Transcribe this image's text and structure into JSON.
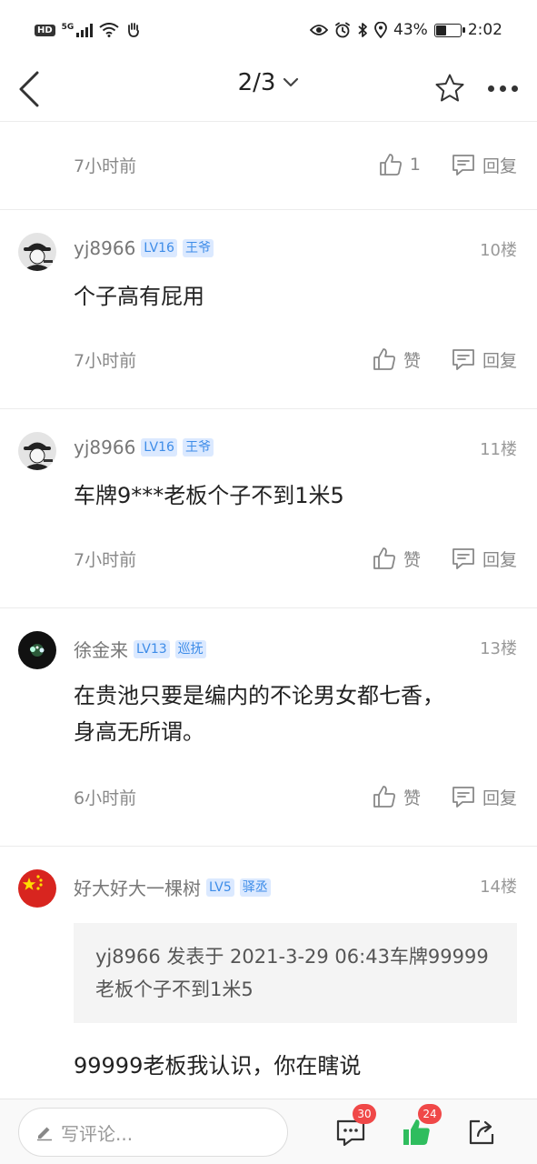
{
  "status": {
    "hd": "HD",
    "network": "5G",
    "battery": "43%",
    "battery_level": 0.43,
    "time": "2:02"
  },
  "nav": {
    "page_indicator": "2/3"
  },
  "colors": {
    "badge_bg": "#dbe9ff",
    "badge_text": "#3d8ce8",
    "like_active": "#2fbd5e",
    "count_badge": "#f04848"
  },
  "comments": [
    {
      "time": "7小时前",
      "like_label": "1",
      "reply_label": "回复"
    },
    {
      "username": "yj8966",
      "level": "LV16",
      "title": "王爷",
      "floor": "10楼",
      "content": "个子高有屁用",
      "time": "7小时前",
      "like_label": "赞",
      "reply_label": "回复"
    },
    {
      "username": "yj8966",
      "level": "LV16",
      "title": "王爷",
      "floor": "11楼",
      "content": "车牌9***老板个子不到1米5",
      "time": "7小时前",
      "like_label": "赞",
      "reply_label": "回复"
    },
    {
      "username": "徐金来",
      "level": "LV13",
      "title": "巡抚",
      "floor": "13楼",
      "content": "在贵池只要是编内的不论男女都七香，身高无所谓。",
      "time": "6小时前",
      "like_label": "赞",
      "reply_label": "回复"
    },
    {
      "username": "好大好大一棵树",
      "level": "LV5",
      "title": "驿丞",
      "floor": "14楼",
      "quote": "yj8966 发表于 2021-3-29 06:43车牌99999老板个子不到1米5",
      "content": "99999老板我认识，你在瞎说"
    }
  ],
  "bottom": {
    "input_placeholder": "写评论...",
    "comment_count": "30",
    "like_count": "24"
  }
}
